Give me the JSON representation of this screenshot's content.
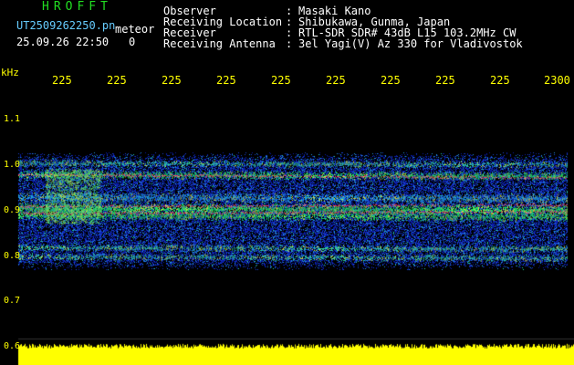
{
  "header": {
    "logo": "HROFFT",
    "filename": "UT2509262250.pn",
    "meteor_label": "meteor",
    "datetime": "25.09.26 22:50",
    "count": "0",
    "fields": [
      {
        "label": "Observer",
        "colon": ":",
        "value": "Masaki Kano"
      },
      {
        "label": "Receiving Location",
        "colon": ":",
        "value": "Shibukawa, Gunma, Japan"
      },
      {
        "label": "Receiver",
        "colon": ":",
        "value": "RTL-SDR SDR# 43dB L15 103.2MHz CW"
      },
      {
        "label": "Receiving Antenna",
        "colon": ":",
        "value": "3el Yagi(V) Az 330 for Vladivostok"
      }
    ]
  },
  "axes": {
    "y_unit": "kHz",
    "y_ticks": [
      "1.1",
      "1.0",
      "0.9",
      "0.8",
      "0.7",
      "0.6"
    ],
    "x_ticks": [
      "225",
      "225",
      "225",
      "225",
      "225",
      "225",
      "225",
      "225",
      "225",
      "2300"
    ]
  },
  "colors": {
    "background": "#000000",
    "axis_text": "#ffff00",
    "header_text": "#ffffff",
    "logo": "#22dd22",
    "filename": "#66ccff",
    "signal_strong": "#ff3060",
    "signal_mid": "#20e060",
    "noise": "#1a40d0",
    "power_bar": "#ffff00"
  },
  "spectrogram": {
    "strong_lines_khz": [
      0.98,
      0.91,
      0.895
    ],
    "noise_band_khz": [
      0.77,
      1.03
    ],
    "power_level_fraction": 0.9
  }
}
